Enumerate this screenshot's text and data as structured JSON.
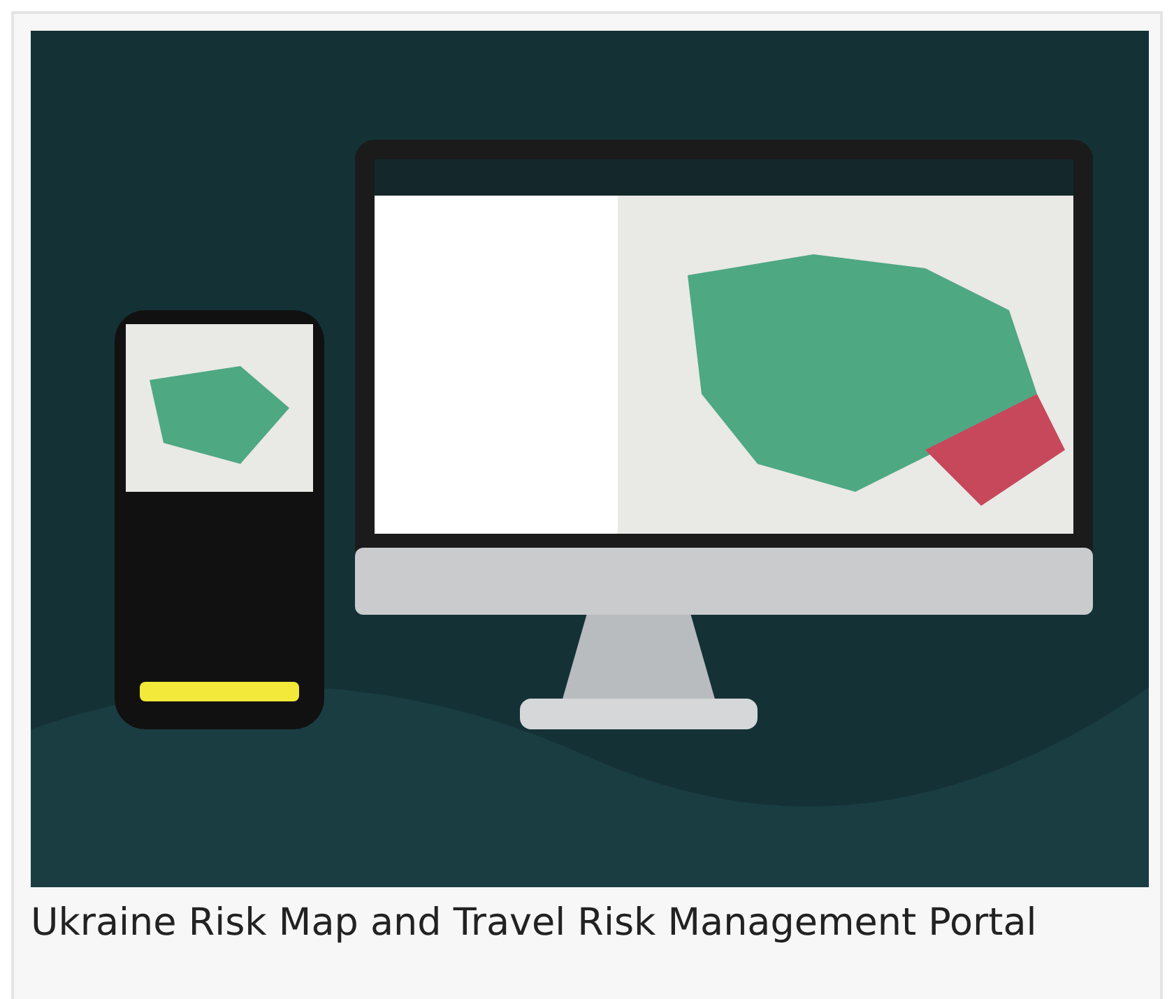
{
  "figure": {
    "caption": "Ukraine Risk Map and Travel Risk Management Portal"
  }
}
